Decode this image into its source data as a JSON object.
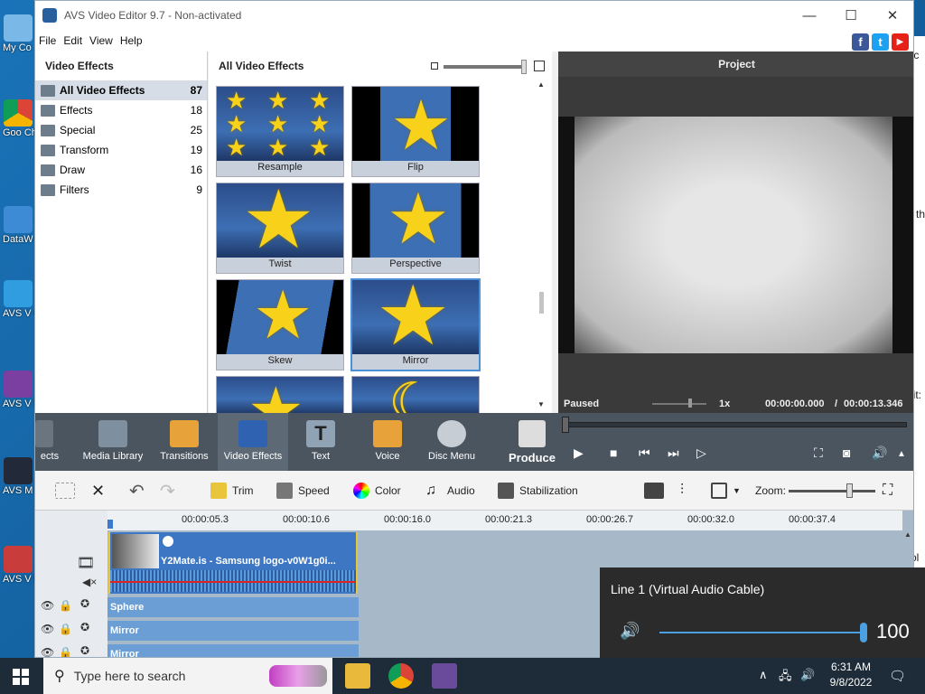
{
  "desktop": {
    "icons": [
      {
        "label": "My Co"
      },
      {
        "label": "Goo Chro"
      },
      {
        "label": "DataW"
      },
      {
        "label": "AVS V Conv"
      },
      {
        "label": "AVS V Edi"
      },
      {
        "label": "AVS M Pla"
      },
      {
        "label": "AVS V ReM"
      }
    ],
    "background_window_fragments": [
      "tc",
      "l th",
      "lit:",
      "ol"
    ]
  },
  "window": {
    "title": "AVS Video Editor 9.7 - Non-activated",
    "menu": [
      "File",
      "Edit",
      "View",
      "Help"
    ],
    "social": [
      "f",
      "t",
      "▶"
    ]
  },
  "effects_panel": {
    "title": "Video Effects",
    "categories": [
      {
        "label": "All Video Effects",
        "count": "87",
        "selected": true
      },
      {
        "label": "Effects",
        "count": "18"
      },
      {
        "label": "Special",
        "count": "25"
      },
      {
        "label": "Transform",
        "count": "19"
      },
      {
        "label": "Draw",
        "count": "16"
      },
      {
        "label": "Filters",
        "count": "9"
      }
    ]
  },
  "gallery": {
    "title": "All Video Effects",
    "tiles": [
      {
        "label": "Resample"
      },
      {
        "label": "Flip"
      },
      {
        "label": "Twist"
      },
      {
        "label": "Perspective"
      },
      {
        "label": "Skew"
      },
      {
        "label": "Mirror",
        "selected": true
      }
    ]
  },
  "project": {
    "title": "Project",
    "status": "Paused",
    "speed": "1x",
    "current_time": "00:00:00.000",
    "separator": "/",
    "total_time": "00:00:13.346"
  },
  "toolbar": {
    "items": [
      {
        "label": "ects"
      },
      {
        "label": "Media Library"
      },
      {
        "label": "Transitions"
      },
      {
        "label": "Video Effects",
        "selected": true
      },
      {
        "label": "Text"
      },
      {
        "label": "Voice"
      },
      {
        "label": "Disc Menu"
      },
      {
        "label": "Produce"
      }
    ]
  },
  "editbar": {
    "trim": "Trim",
    "speed": "Speed",
    "color": "Color",
    "audio": "Audio",
    "stabilization": "Stabilization",
    "zoom": "Zoom:"
  },
  "timeline": {
    "ticks": [
      "00:00:05.3",
      "00:00:10.6",
      "00:00:16.0",
      "00:00:21.3",
      "00:00:26.7",
      "00:00:32.0",
      "00:00:37.4"
    ],
    "clip_title": "Y2Mate.is - Samsung logo-v0W1g0i...",
    "effect_rows": [
      "Sphere",
      "Mirror",
      "Mirror"
    ]
  },
  "volume_popup": {
    "device": "Line 1 (Virtual Audio Cable)",
    "value": "100",
    "level_percent": 100
  },
  "taskbar": {
    "search_placeholder": "Type here to search",
    "time": "6:31 AM",
    "date": "9/8/2022"
  }
}
